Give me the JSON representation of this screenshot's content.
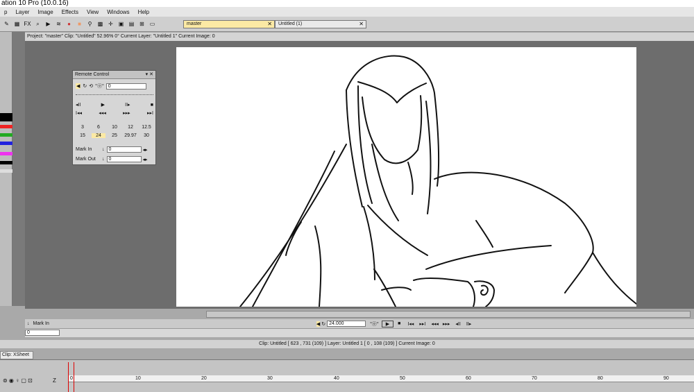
{
  "window": {
    "title": "ation 10 Pro (10.0.16)"
  },
  "menu": [
    "p",
    "Layer",
    "Image",
    "Effects",
    "View",
    "Windows",
    "Help"
  ],
  "toolbar": {
    "fx_label": "FX"
  },
  "tabs": [
    {
      "label": "master"
    },
    {
      "label": "Untitled (1)"
    }
  ],
  "status": "Project: \"master\" Clip: \"Untitled\"  52.96%  0°  Current Layer: \"Untitled 1\"  Current Image: 0",
  "remote": {
    "title": "Remote Control",
    "value": "0",
    "fps_row1": [
      "3",
      "6",
      "10",
      "12",
      "12.5"
    ],
    "fps_row2": [
      "15",
      "24",
      "25",
      "29.97",
      "30"
    ],
    "selected_fps": "24",
    "mark_in_label": "Mark In",
    "mark_in_value": "0",
    "mark_out_label": "Mark Out",
    "mark_out_value": "0"
  },
  "frame": {
    "mark_in_label": "Mark In",
    "speed": "24.000",
    "current": "0"
  },
  "info": "Clip: Untitled [ 623 , 731  (109) ]     Layer: Untitled 1 [ 0 , 108  (109) ]     Current Image: 0",
  "xsheet": {
    "tab": "Clip: XSheet",
    "z_label": "Z",
    "ticks": [
      "0",
      "10",
      "20",
      "30",
      "40",
      "50",
      "60",
      "70",
      "80",
      "90"
    ]
  },
  "colors": {
    "workspace": "#6d6d6d",
    "canvas": "#ffffff",
    "active_tab": "#fbe9a4"
  }
}
